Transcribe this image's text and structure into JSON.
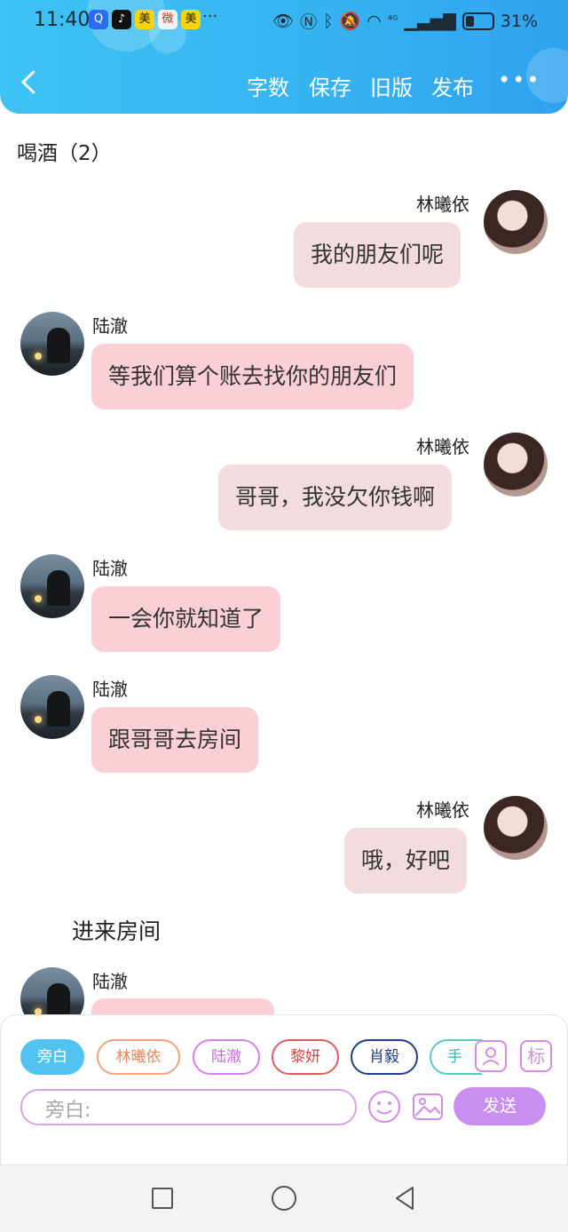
{
  "status_bar": {
    "time": "11:40",
    "app_icons": [
      "Q",
      "♪",
      "美",
      "微",
      "美"
    ],
    "more": "···",
    "signal": "⁴ᴳ",
    "battery": "31%"
  },
  "header": {
    "word_count": "字数",
    "save": "保存",
    "old_version": "旧版",
    "publish": "发布",
    "more": "•••"
  },
  "chapter_title": "喝酒（2）",
  "messages": [
    {
      "speaker": "林曦依",
      "side": "right",
      "text": "我的朋友们呢"
    },
    {
      "speaker": "陆澈",
      "side": "left",
      "text": "等我们算个账去找你的朋友们"
    },
    {
      "speaker": "林曦依",
      "side": "right",
      "text": "哥哥，我没欠你钱啊"
    },
    {
      "speaker": "陆澈",
      "side": "left",
      "text": "一会你就知道了"
    },
    {
      "speaker": "陆澈",
      "side": "left",
      "text": "跟哥哥去房间"
    },
    {
      "speaker": "林曦依",
      "side": "right",
      "text": "哦，好吧"
    }
  ],
  "narration": "进来房间",
  "last_speaker": "陆澈",
  "role_chips": [
    "旁白",
    "林曦依",
    "陆澈",
    "黎妍",
    "肖毅",
    "手"
  ],
  "tag_icon": "标",
  "input": {
    "placeholder": "旁白:"
  },
  "send_label": "发送",
  "colors": {
    "header": "#36b4f2",
    "bubble_self": "#f2dcdd",
    "bubble_other": "#fbcfd6",
    "send": "#c98ff0"
  }
}
